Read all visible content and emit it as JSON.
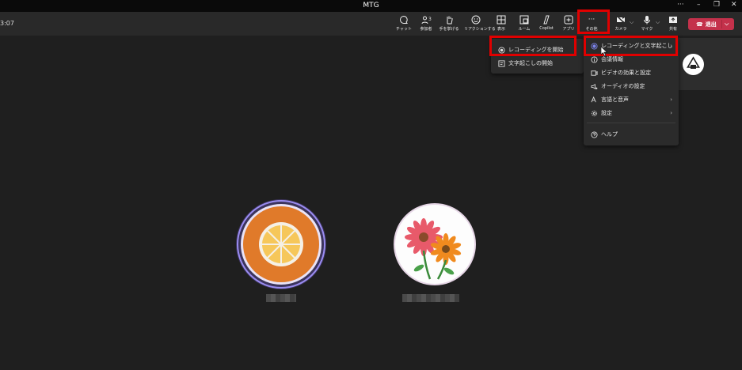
{
  "window": {
    "title": "MTG",
    "more": "···",
    "minimize": "–",
    "maximize": "❐",
    "close": "✕"
  },
  "toolbar": {
    "timer": "3:07",
    "buttons": [
      {
        "label": "チャット",
        "icon": "chat-icon"
      },
      {
        "label": "参加者",
        "icon": "people-icon",
        "count": "3"
      },
      {
        "label": "手を挙げる",
        "icon": "hand-icon"
      },
      {
        "label": "リアクションする",
        "icon": "smile-icon"
      },
      {
        "label": "表示",
        "icon": "grid-icon"
      },
      {
        "label": "ルーム",
        "icon": "room-icon"
      },
      {
        "label": "Copilot",
        "icon": "copilot-icon"
      },
      {
        "label": "アプリ",
        "icon": "plus-icon"
      },
      {
        "label": "その他",
        "icon": "ellipsis-icon"
      },
      {
        "label": "カメラ",
        "icon": "camera-off-icon"
      },
      {
        "label": "マイク",
        "icon": "mic-icon"
      },
      {
        "label": "共有",
        "icon": "share-icon"
      }
    ],
    "leave_label": "退出"
  },
  "more_menu": {
    "items": [
      {
        "label": "レコーディングと文字起こし",
        "icon": "record-icon",
        "has_submenu": true
      },
      {
        "label": "会議情報",
        "icon": "info-icon"
      },
      {
        "label": "ビデオの効果と設定",
        "icon": "video-effects-icon"
      },
      {
        "label": "オーディオの設定",
        "icon": "audio-settings-icon"
      },
      {
        "label": "言語と音声",
        "icon": "language-icon",
        "has_submenu": true
      },
      {
        "label": "設定",
        "icon": "gear-icon",
        "has_submenu": true
      },
      {
        "label": "ヘルプ",
        "icon": "help-icon"
      }
    ]
  },
  "recording_submenu": {
    "items": [
      {
        "label": "レコーディングを開始",
        "icon": "record-icon"
      },
      {
        "label": "文字起こしの開始",
        "icon": "transcript-icon"
      }
    ]
  },
  "colors": {
    "accent": "#7b83eb",
    "leave": "#c4314b",
    "highlight": "#e00000",
    "orange": "#e07a2a"
  }
}
